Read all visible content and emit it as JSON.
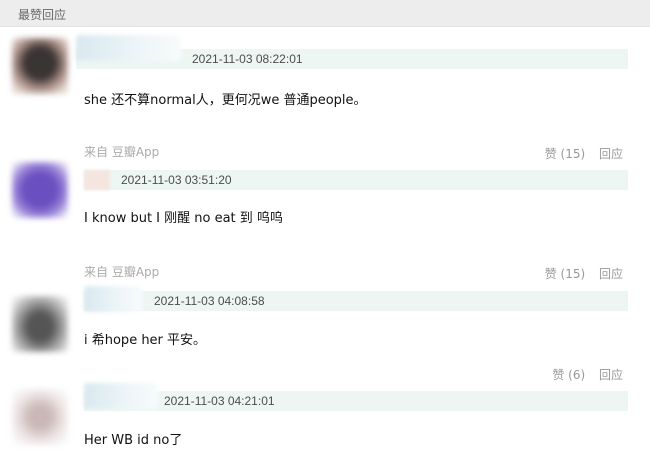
{
  "section": {
    "title": "最赞回应"
  },
  "comments": [
    {
      "time": "2021-11-03 08:22:01",
      "text": "she 还不算normal人，更何况we 普通people。",
      "source": "来自 豆瓣App",
      "like": "赞 (15)",
      "reply": "回应"
    },
    {
      "time": "2021-11-03 03:51:20",
      "text": "I know but I 刚醒 no eat 到 呜呜",
      "source": "来自 豆瓣App",
      "like": "赞 (15)",
      "reply": "回应"
    },
    {
      "time": "2021-11-03 04:08:58",
      "text": "i 希hope her 平安。",
      "like": "赞 (6)",
      "reply": "回应"
    },
    {
      "time": "2021-11-03 04:21:01",
      "text": "Her WB id no了"
    }
  ],
  "colors": {
    "topbar": "#ededed",
    "header_bar": "#eef6f3",
    "meta_text": "#aaaaaa",
    "action_text": "#999999"
  }
}
